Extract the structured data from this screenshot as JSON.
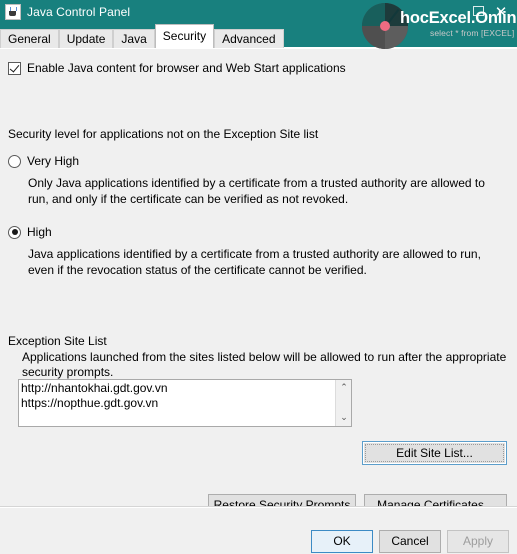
{
  "window": {
    "title": "Java Control Panel",
    "icon": "java-cup-icon",
    "close_label": "✕",
    "titlebar_color": "#18807e"
  },
  "watermark": {
    "name": "hocExcel.Online",
    "tagline": "select * from [EXCEL]"
  },
  "tabs": [
    {
      "label": "General",
      "active": false
    },
    {
      "label": "Update",
      "active": false
    },
    {
      "label": "Java",
      "active": false
    },
    {
      "label": "Security",
      "active": true
    },
    {
      "label": "Advanced",
      "active": false
    }
  ],
  "enable_java": {
    "label": "Enable Java content for browser and Web Start applications",
    "checked": true
  },
  "security_level": {
    "heading": "Security level for applications not on the Exception Site list",
    "options": [
      {
        "label": "Very High",
        "selected": false,
        "description": "Only Java applications identified by a certificate from a trusted authority are allowed to run, and only if the certificate can be verified as not revoked."
      },
      {
        "label": "High",
        "selected": true,
        "description": "Java applications identified by a certificate from a trusted authority are allowed to run, even if the revocation status of the certificate cannot be verified."
      }
    ]
  },
  "exception_site_list": {
    "heading": "Exception Site List",
    "description": "Applications launched from the sites listed below will be allowed to run after the appropriate security prompts.",
    "sites": [
      "http://nhantokhai.gdt.gov.vn",
      "https://nopthue.gdt.gov.vn"
    ],
    "scroll_up_icon": "⌃",
    "scroll_down_icon": "⌄",
    "edit_button": "Edit Site List..."
  },
  "actions": {
    "restore_security_prompts": "Restore Security Prompts",
    "manage_certificates": "Manage Certificates..."
  },
  "footer": {
    "ok": "OK",
    "cancel": "Cancel",
    "apply": "Apply",
    "apply_enabled": false
  }
}
